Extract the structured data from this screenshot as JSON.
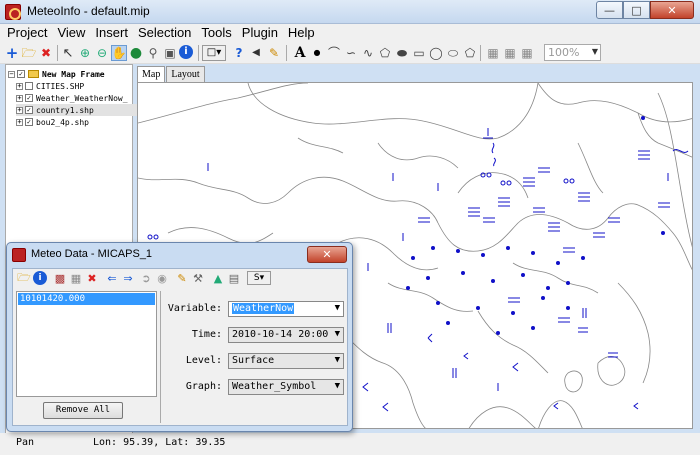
{
  "window": {
    "title": "MeteoInfo - default.mip"
  },
  "menu": [
    "Project",
    "View",
    "Insert",
    "Selection",
    "Tools",
    "Plugin",
    "Help"
  ],
  "toolbar": {
    "zoom": "100%",
    "tools": [
      "new-project-icon",
      "open-folder-icon",
      "delete-icon",
      "select-icon",
      "zoom-in-icon",
      "zoom-out-icon",
      "pan-hand-icon",
      "full-extent-globe-icon",
      "zoom-to-layer-icon",
      "zoom-window-icon",
      "identify-icon",
      "select-feature-icon",
      "measure-icon",
      "label-icon",
      "edit-icon",
      "text-icon",
      "point-icon",
      "polyline-icon",
      "freehand-line-icon",
      "curve-icon",
      "polygon-icon",
      "curve-polygon-icon",
      "rectangle-icon",
      "circle-icon",
      "ellipse-icon",
      "freehand-polygon-icon",
      "print-layout-icon",
      "copy-layout-icon",
      "export-layout-icon"
    ]
  },
  "legend": {
    "group": "New Map Frame",
    "layers": [
      {
        "name": "CITIES.SHP",
        "checked": false,
        "selected": false
      },
      {
        "name": "Weather_WeatherNow_",
        "checked": true,
        "selected": false
      },
      {
        "name": "country1.shp",
        "checked": true,
        "selected": true
      },
      {
        "name": "bou2_4p.shp",
        "checked": true,
        "selected": false
      }
    ]
  },
  "tabs": [
    "Map",
    "Layout"
  ],
  "status": {
    "mode": "Pan",
    "coords": "Lon: 95.39, Lat: 39.35"
  },
  "dialog": {
    "title": "Meteo Data - MICAPS_1",
    "close_glyph": "✕",
    "files": [
      "10101420.000"
    ],
    "remove_all": "Remove All",
    "fields": {
      "variable": {
        "label": "Variable:",
        "value": "WeatherNow"
      },
      "time": {
        "label": "Time:",
        "value": "2010-10-14 20:00"
      },
      "level": {
        "label": "Level:",
        "value": "Surface"
      },
      "graph": {
        "label": "Graph:",
        "value": "Weather_Symbol"
      }
    }
  },
  "colors": {
    "symbol": "#1010c8",
    "border": "#888888",
    "accent": "#3399ff"
  }
}
